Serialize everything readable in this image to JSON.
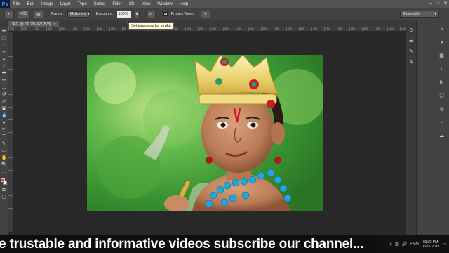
{
  "app": {
    "logo": "Ps"
  },
  "menu": [
    "File",
    "Edit",
    "Image",
    "Layer",
    "Type",
    "Select",
    "Filter",
    "3D",
    "View",
    "Window",
    "Help"
  ],
  "window_controls": {
    "minimize": "–",
    "maximize": "□",
    "close": "✕"
  },
  "options": {
    "brush_size": "400",
    "range_label": "Range:",
    "range_value": "Midtones",
    "exposure_label": "Exposure:",
    "exposure_value": "100%",
    "protect_tones_label": "Protect Tones",
    "protect_tones_checked": true,
    "workspace": "Essentials",
    "tooltip": "Set exposure for stroke"
  },
  "document": {
    "tab_title": "JPG @ 16.7% (RGB/8)",
    "close": "×"
  },
  "rulers": {
    "h_ticks": [
      "500",
      "450",
      "400",
      "350",
      "300",
      "250",
      "200",
      "150",
      "100",
      "50",
      "0",
      "50",
      "100",
      "150",
      "200",
      "250",
      "300",
      "350",
      "400",
      "450",
      "500",
      "550",
      "600",
      "650",
      "700",
      "750",
      "800",
      "850",
      "900",
      "950",
      "1000",
      "1050"
    ]
  },
  "colors": {
    "foreground": "#e04a1c",
    "background": "#ffffff"
  },
  "banner": {
    "text": "e trustable and informative videos subscribe our channel..."
  },
  "taskbar": {
    "lang": "ENG",
    "time": "03:23 PM",
    "date": "06-11-2019"
  }
}
